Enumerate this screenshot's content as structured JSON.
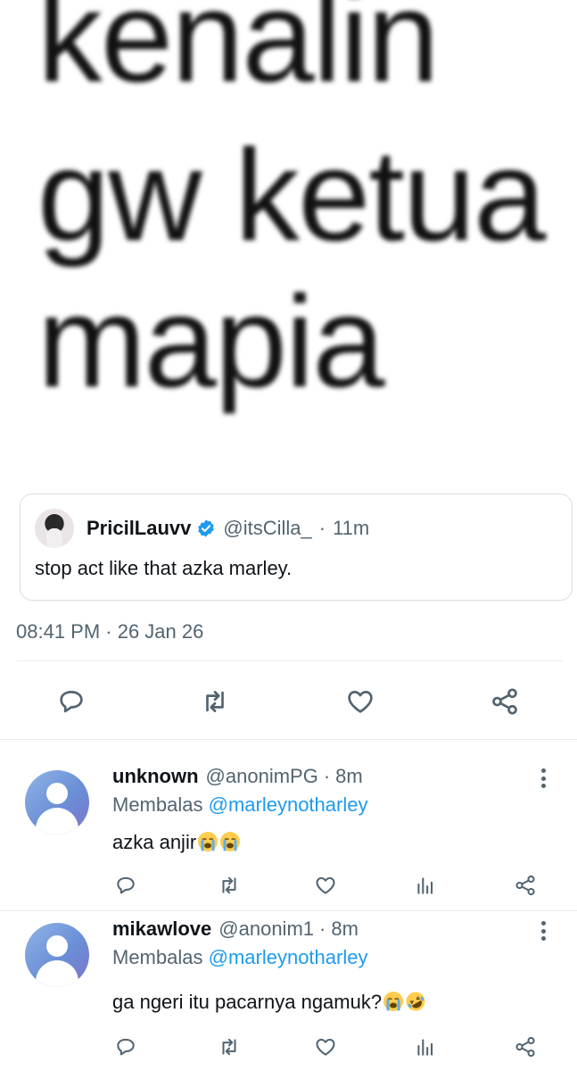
{
  "meme": {
    "line1": "kenalin",
    "line2": "gw ketua",
    "line3": "mapia"
  },
  "quoted_tweet": {
    "display_name": "PricilLauvv",
    "verified": true,
    "handle": "@itsCilla_",
    "separator": "·",
    "time_ago": "11m",
    "text": "stop act like that azka marley."
  },
  "tweet": {
    "timestamp": "08:41 PM · 26 Jan 26"
  },
  "actions": {
    "icons": [
      "reply-icon",
      "retweet-icon",
      "like-icon",
      "share-icon"
    ]
  },
  "replies": [
    {
      "display_name": "unknown",
      "handle": "@anonimPG",
      "separator": "·",
      "time_ago": "8m",
      "replying_label": "Membalas",
      "replying_to": "@marleynotharley",
      "text": "azka anjir",
      "emojis": [
        "loudly-crying-face",
        "loudly-crying-face"
      ]
    },
    {
      "display_name": "mikawlove",
      "handle": "@anonim1",
      "separator": "·",
      "time_ago": "8m",
      "replying_label": "Membalas",
      "replying_to": "@marleynotharley",
      "text": "ga ngeri itu pacarnya ngamuk?",
      "emojis": [
        "loudly-crying-face",
        "rolling-on-floor-laughing"
      ]
    }
  ],
  "colors": {
    "text_primary": "#0f1419",
    "text_secondary": "#536471",
    "link": "#1d9bf0",
    "verified": "#1d9bf0",
    "divider": "#e6ecf0"
  }
}
